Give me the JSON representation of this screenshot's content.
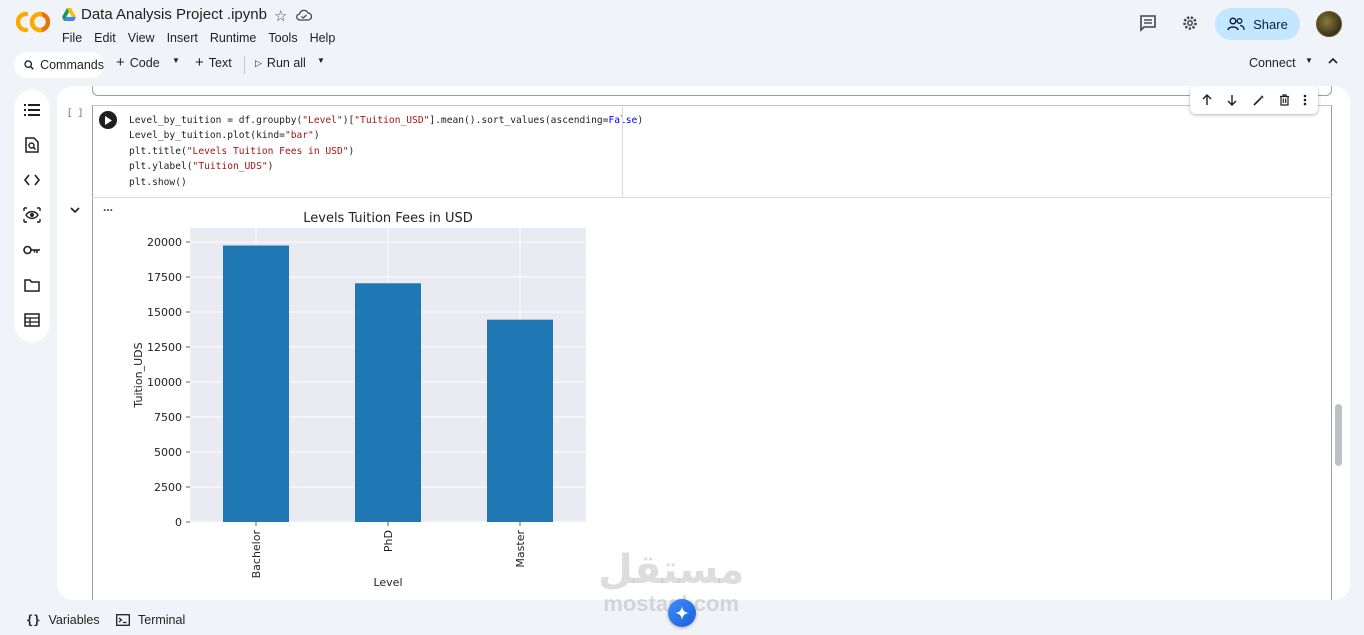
{
  "header": {
    "title": "Data Analysis Project .ipynb",
    "menu": [
      "File",
      "Edit",
      "View",
      "Insert",
      "Runtime",
      "Tools",
      "Help"
    ],
    "share_label": "Share"
  },
  "toolbar": {
    "commands_label": "Commands",
    "code_label": "Code",
    "text_label": "Text",
    "run_all_label": "Run all",
    "connect_label": "Connect"
  },
  "cell": {
    "exec_count": "[ ]",
    "output_dots": "...",
    "code_lines": [
      "Level_by_tuition = df.groupby(\"Level\")[\"Tuition_USD\"].mean().sort_values(ascending=False)",
      "Level_by_tuition.plot(kind=\"bar\")",
      "plt.title(\"Levels Tuition Fees in USD\")",
      "plt.ylabel(\"Tuition_UDS\")",
      "plt.show()"
    ]
  },
  "chart_data": {
    "type": "bar",
    "title": "Levels Tuition Fees in USD",
    "xlabel": "Level",
    "ylabel": "Tuition_UDS",
    "categories": [
      "Bachelor",
      "PhD",
      "Master"
    ],
    "values": [
      19750,
      17050,
      14450
    ],
    "ylim": [
      0,
      21000
    ],
    "yticks": [
      0,
      2500,
      5000,
      7500,
      10000,
      12500,
      15000,
      17500,
      20000
    ],
    "grid": true,
    "bar_color": "#1f77b4",
    "plot_bg": "#eaeaf2"
  },
  "bottom": {
    "variables_label": "Variables",
    "terminal_label": "Terminal"
  },
  "watermark": {
    "arabic": "مستقل",
    "latin": "mostaql.com"
  }
}
